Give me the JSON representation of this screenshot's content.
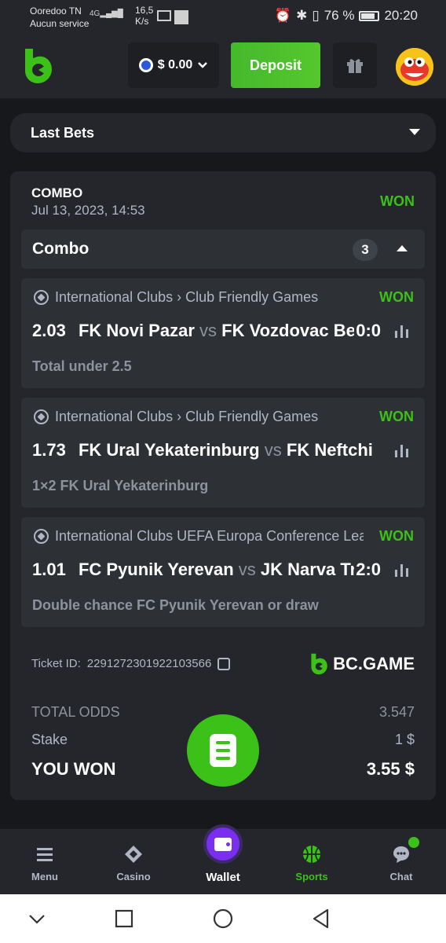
{
  "status_bar": {
    "carrier": "Ooredoo TN",
    "carrier_sub": "Aucun service",
    "network": "4G",
    "speed": "16,5",
    "speed_unit": "K/s",
    "battery": "76 %",
    "time": "20:20"
  },
  "header": {
    "balance": "$ 0.00",
    "deposit_label": "Deposit",
    "brand_color": "#3bc117"
  },
  "filter": {
    "label": "Last Bets"
  },
  "bet": {
    "type": "COMBO",
    "date": "Jul 13, 2023, 14:53",
    "status": "WON",
    "group_label": "Combo",
    "leg_count": "3",
    "legs": [
      {
        "league": "International Clubs › Club Friendly Games",
        "status": "WON",
        "odds": "2.03",
        "home": "FK Novi Pazar",
        "vs": "vs",
        "away": "FK Vozdovac Beograd",
        "score": "0:0",
        "market": "Total under 2.5"
      },
      {
        "league": "International Clubs › Club Friendly Games",
        "status": "WON",
        "odds": "1.73",
        "home": "FK Ural Yekaterinburg",
        "vs": "vs",
        "away": "FK Neftchi",
        "score": "",
        "market": "1×2 FK Ural Yekaterinburg"
      },
      {
        "league": "International Clubs UEFA Europa Conference League",
        "status": "WON",
        "odds": "1.01",
        "home": "FC Pyunik Yerevan",
        "vs": "vs",
        "away": "JK Narva Trans",
        "score": "2:0",
        "market": "Double chance FC Pyunik Yerevan or draw"
      }
    ],
    "ticket_label": "Ticket ID:",
    "ticket_id": "2291272301922103566",
    "brand": "BC.GAME",
    "total_odds_label": "TOTAL ODDS",
    "total_odds": "3.547",
    "stake_label": "Stake",
    "stake": "1 $",
    "won_label": "YOU WON",
    "won_amount": "3.55 $"
  },
  "bottom_nav": [
    {
      "label": "Menu",
      "icon": "menu-icon"
    },
    {
      "label": "Casino",
      "icon": "casino-icon"
    },
    {
      "label": "Wallet",
      "icon": "wallet-icon"
    },
    {
      "label": "Sports",
      "icon": "basketball-icon"
    },
    {
      "label": "Chat",
      "icon": "chat-icon"
    }
  ]
}
